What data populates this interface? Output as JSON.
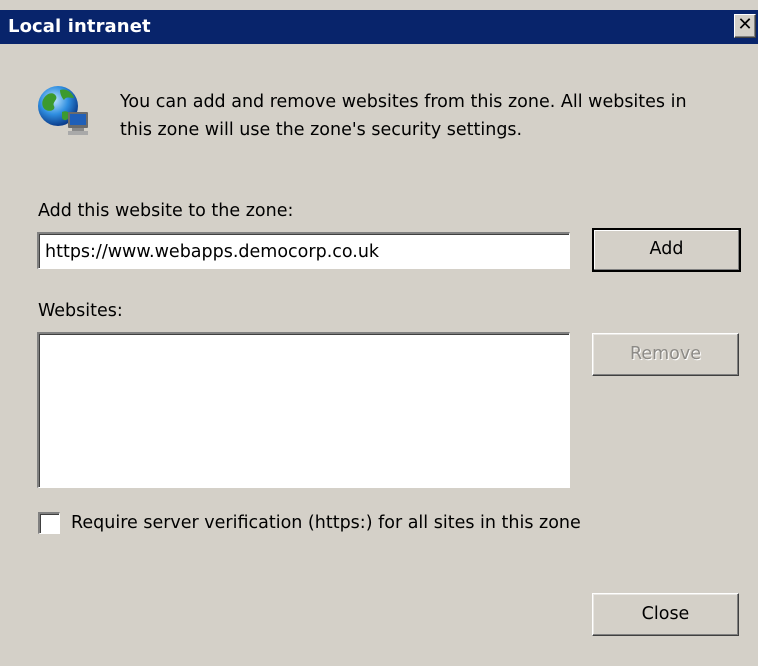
{
  "window": {
    "title": "Local intranet",
    "close_glyph": "✕"
  },
  "intro": {
    "line1": "You can add and remove websites from this zone. All websites in",
    "line2": "this zone will use the zone's security settings."
  },
  "add_site": {
    "label": "Add this website to the zone:",
    "value": "https://www.webapps.democorp.co.uk",
    "add_button": "Add"
  },
  "websites": {
    "label": "Websites:",
    "items": [],
    "remove_button": "Remove"
  },
  "require_verification": {
    "label": "Require server verification (https:) for all sites in this zone",
    "checked": false
  },
  "footer": {
    "close_button": "Close"
  },
  "icons": {
    "zone_icon": "globe-computer-icon"
  },
  "colors": {
    "title_bar": "#08246b",
    "dialog_bg": "#d4d0c8"
  }
}
